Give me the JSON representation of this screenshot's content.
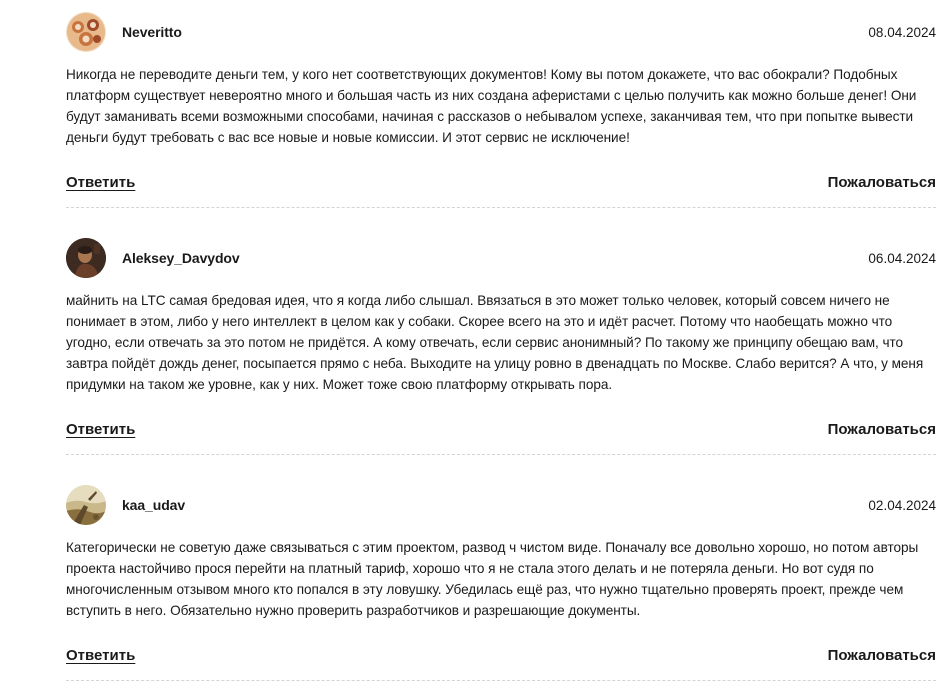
{
  "comments": [
    {
      "author": "Neveritto",
      "date": "08.04.2024",
      "text": "Никогда не переводите деньги тем, у кого нет соответствующих документов! Кому вы потом докажете, что вас обокрали? Подобных платформ существует невероятно много и большая часть из них создана аферистами с целью получить как можно больше денег! Они будут заманивать всеми возможными способами, начиная с рассказов о небывалом успехе, заканчивая тем, что при попытке вывести деньги будут требовать с вас все новые и новые комиссии. И этот сервис не исключение!",
      "avatar_colors": [
        "#f2dcc3",
        "#c9743f",
        "#a04b2a",
        "#e8b98a"
      ]
    },
    {
      "author": "Aleksey_Davydov",
      "date": "06.04.2024",
      "text": "майнить на LTC самая бредовая идея, что я когда либо слышал. Ввязаться в это может только человек, который совсем ничего не понимает в этом, либо у него интеллект в целом как у собаки. Скорее всего на это и идёт расчет. Потому что наобещать можно что угодно, если отвечать за это потом не придётся. А кому отвечать, если сервис анонимный? По такому же принципу обещаю вам, что завтра пойдёт дождь денег, посыпается прямо с неба. Выходите на улицу ровно в двенадцать по Москве. Слабо верится? А что, у меня придумки на таком же уровне, как у них. Может тоже свою платформу открывать пора.",
      "avatar_colors": [
        "#2a1c17",
        "#6b3f2a",
        "#a8764f",
        "#3d2a20"
      ]
    },
    {
      "author": "kaa_udav",
      "date": "02.04.2024",
      "text": "Категорически не советую даже связываться с этим проектом, развод ч чистом виде. Поначалу все довольно хорошо, но потом авторы проекта настойчиво прося перейти на платный тариф, хорошо что я не стала этого делать и не потеряла деньги. Но вот судя по многочисленным отзывом много кто попался в эту ловушку. Убедилась ещё раз, что нужно тщательно проверять проект, прежде чем вступить в него. Обязательно нужно проверить разработчиков и разрешающие документы.",
      "avatar_colors": [
        "#c9b98a",
        "#8a6f3e",
        "#e6dcc0",
        "#5e4a2a"
      ]
    }
  ],
  "actions": {
    "reply_label": "Ответить",
    "report_label": "Пожаловаться"
  }
}
